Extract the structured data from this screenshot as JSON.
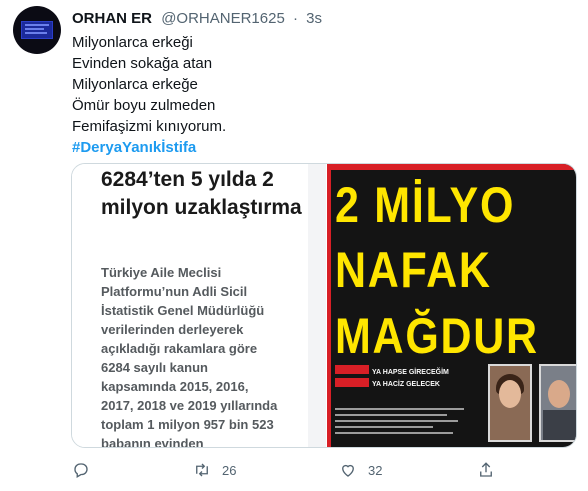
{
  "tweet": {
    "author_name": "ORHAN ER",
    "author_handle": "@ORHANER1625",
    "separator": "·",
    "timestamp": "3s",
    "lines": [
      "Milyonlarca erkeği",
      "Evinden sokağa atan",
      "Milyonlarca erkeğe",
      "Ömür boyu zulmeden",
      "Femifaşizmi kınıyorum."
    ],
    "hashtag": "#DeryaYanıkİstifa"
  },
  "media": {
    "article_title": "6284’ten 5 yılda 2 milyon uzaklaştırma",
    "article_body": [
      "Türkiye Aile Meclisi",
      "Platformu’nun Adli Sicil",
      "İstatistik Genel Müdürlüğü",
      "verilerinden derleyerek",
      "açıkladığı rakamlara göre",
      "6284 sayılı kanun",
      "kapsamında 2015, 2016,",
      "2017, 2018 ve 2019 yıllarında",
      "toplam 1 milyon 957 bin 523",
      "babanın evinden"
    ],
    "headline_lines": [
      "2 MİLYO",
      "NAFAK",
      "MAĞDUR"
    ],
    "caption_lines": [
      "YA HAPSE GİRECEĞİM",
      "YA HACİZ GELECEK"
    ]
  },
  "actions": {
    "reply_count": "",
    "retweet_count": "26",
    "like_count": "32",
    "share_count": ""
  },
  "colors": {
    "link": "#1d9bf0",
    "secondary_text": "#536471",
    "headline_yellow": "#ffe600",
    "headline_red": "#d81f26"
  },
  "icons": [
    "reply-icon",
    "retweet-icon",
    "heart-icon",
    "share-icon"
  ]
}
